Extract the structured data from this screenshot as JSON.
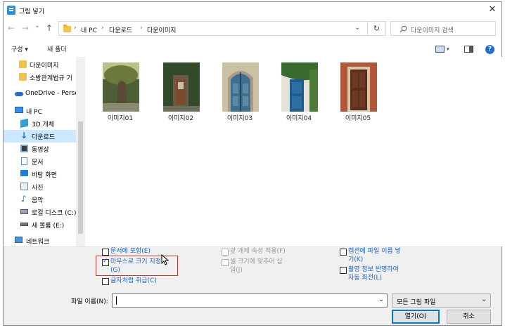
{
  "window": {
    "title": "그림 넣기",
    "close_glyph": "✕"
  },
  "nav": {
    "back": "←",
    "forward": "→",
    "recent": "⌄",
    "up": "↑"
  },
  "address": {
    "crumbs": [
      "내 PC",
      "다운로드",
      "다운이미지"
    ],
    "separator": "›",
    "dropdown": "⌄",
    "refresh": "↻"
  },
  "search": {
    "placeholder": "다운이미지 검색"
  },
  "toolbar": {
    "organize": "구성 ▾",
    "new_folder": "새 폴더",
    "help": "?"
  },
  "sidebar": {
    "items": [
      {
        "label": "다운이미지",
        "icon": "folder-icon"
      },
      {
        "label": "소방관계법규 기",
        "icon": "folder-icon"
      },
      {
        "label": "OneDrive - Perso",
        "icon": "cloud-icon"
      },
      {
        "label": "내 PC",
        "icon": "pc-icon"
      },
      {
        "label": "3D 개체",
        "icon": "cube-icon"
      },
      {
        "label": "다운로드",
        "icon": "download-icon",
        "selected": true
      },
      {
        "label": "동영상",
        "icon": "video-icon"
      },
      {
        "label": "문서",
        "icon": "document-icon"
      },
      {
        "label": "바탕 화면",
        "icon": "desktop-icon"
      },
      {
        "label": "사진",
        "icon": "picture-icon"
      },
      {
        "label": "음악",
        "icon": "music-icon"
      },
      {
        "label": "로컬 디스크 (C:)",
        "icon": "drive-icon"
      },
      {
        "label": "새 볼륨 (E:)",
        "icon": "drive-icon"
      },
      {
        "label": "네트워크",
        "icon": "network-icon"
      }
    ]
  },
  "files": [
    {
      "name": "이미지01"
    },
    {
      "name": "이미지02"
    },
    {
      "name": "이미지03"
    },
    {
      "name": "이미지04"
    },
    {
      "name": "이미지05"
    }
  ],
  "options": {
    "include_in_doc": "문서에 포함(E)",
    "mouse_size_1": "마우스로 크기 지정",
    "mouse_size_2": "(G)",
    "as_char": "글자처럼 취급(C)",
    "front_prop": "앞 개체 속성 적용(F)",
    "fit_cell_1": "셀 크기에 맞추어 삽",
    "fit_cell_2": "입(J)",
    "caption_1": "캡션에 파일 이름 넣",
    "caption_2": "기(K)",
    "rotate_1": "촬영 정보 반영하여",
    "rotate_2": "자동 회전(L)"
  },
  "filename": {
    "label": "파일 이름(N):",
    "value": "",
    "dropdown": "⌄"
  },
  "filetype": {
    "value": "모든 그림 파일",
    "dropdown": "⌄"
  },
  "buttons": {
    "open": "열기(O)",
    "cancel": "취소"
  }
}
